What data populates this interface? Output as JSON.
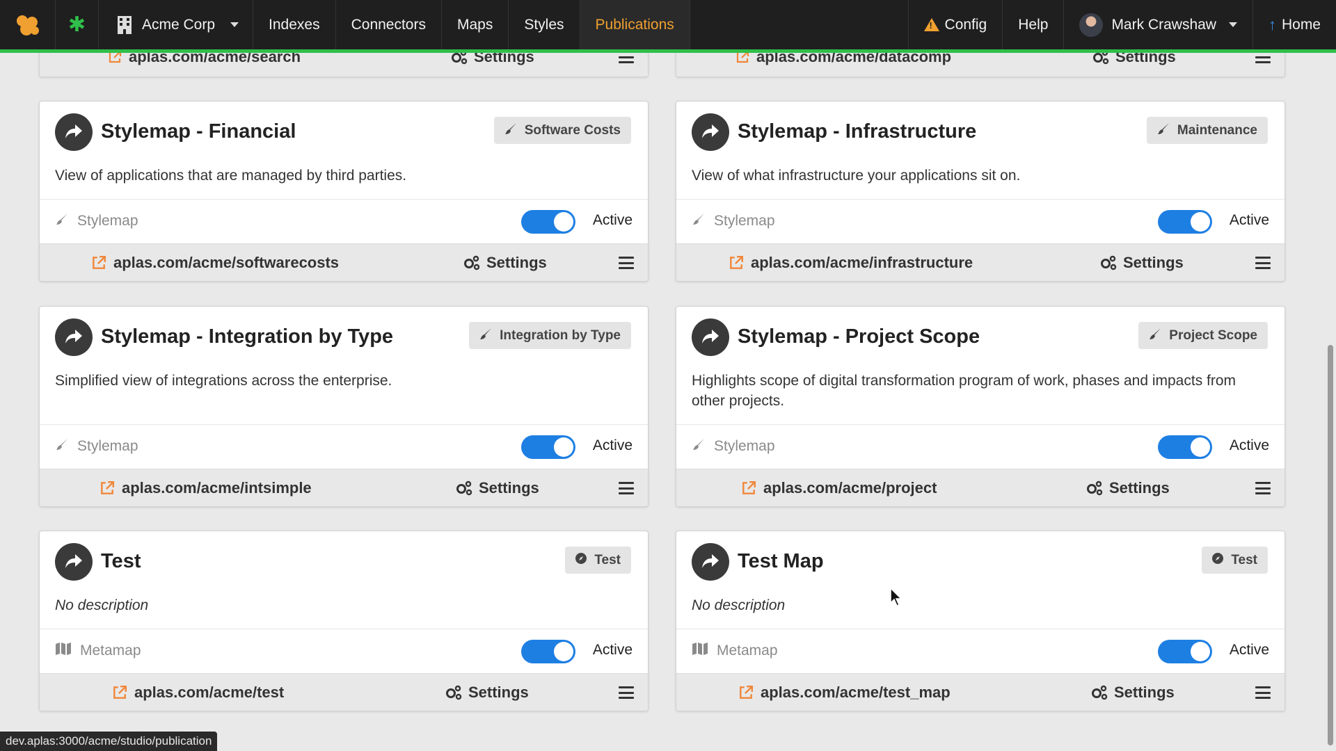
{
  "nav": {
    "org": "Acme Corp",
    "items": [
      "Indexes",
      "Connectors",
      "Maps",
      "Styles",
      "Publications"
    ],
    "active": "Publications",
    "config": "Config",
    "help": "Help",
    "user": "Mark Crawshaw",
    "home": "Home"
  },
  "partial_cards": [
    {
      "link": "aplas.com/acme/search",
      "settings": "Settings"
    },
    {
      "link": "aplas.com/acme/datacomp",
      "settings": "Settings"
    }
  ],
  "cards": [
    {
      "title": "Stylemap - Financial",
      "tag": "Software Costs",
      "tag_icon": "brush-icon",
      "description": "View of applications that are managed by third parties.",
      "type": "Stylemap",
      "type_icon": "brush-icon",
      "status": "Active",
      "link": "aplas.com/acme/softwarecosts",
      "settings": "Settings"
    },
    {
      "title": "Stylemap - Infrastructure",
      "tag": "Maintenance",
      "tag_icon": "brush-icon",
      "description": "View of what infrastructure your applications sit on.",
      "type": "Stylemap",
      "type_icon": "brush-icon",
      "status": "Active",
      "link": "aplas.com/acme/infrastructure",
      "settings": "Settings"
    },
    {
      "title": "Stylemap - Integration by Type",
      "tag": "Integration by Type",
      "tag_icon": "brush-icon",
      "description": "Simplified view of integrations across the enterprise.",
      "type": "Stylemap",
      "type_icon": "brush-icon",
      "status": "Active",
      "link": "aplas.com/acme/intsimple",
      "settings": "Settings"
    },
    {
      "title": "Stylemap - Project Scope",
      "tag": "Project Scope",
      "tag_icon": "brush-icon",
      "description": "Highlights scope of digital transformation program of work, phases and impacts from other projects.",
      "type": "Stylemap",
      "type_icon": "brush-icon",
      "status": "Active",
      "link": "aplas.com/acme/project",
      "settings": "Settings"
    },
    {
      "title": "Test",
      "tag": "Test",
      "tag_icon": "compass-icon",
      "description": "No description",
      "type": "Metamap",
      "type_icon": "map-icon",
      "status": "Active",
      "link": "aplas.com/acme/test",
      "settings": "Settings"
    },
    {
      "title": "Test Map",
      "tag": "Test",
      "tag_icon": "compass-icon",
      "description": "No description",
      "type": "Metamap",
      "type_icon": "map-icon",
      "status": "Active",
      "link": "aplas.com/acme/test_map",
      "settings": "Settings"
    }
  ],
  "status_url": "dev.aplas:3000/acme/studio/publication",
  "colors": {
    "nav_bg": "#1f1f1f",
    "nav_accent": "#2fbf4a",
    "active_nav": "#f0a030",
    "toggle_on": "#1e7fe3",
    "link_icon": "#f0873a"
  }
}
